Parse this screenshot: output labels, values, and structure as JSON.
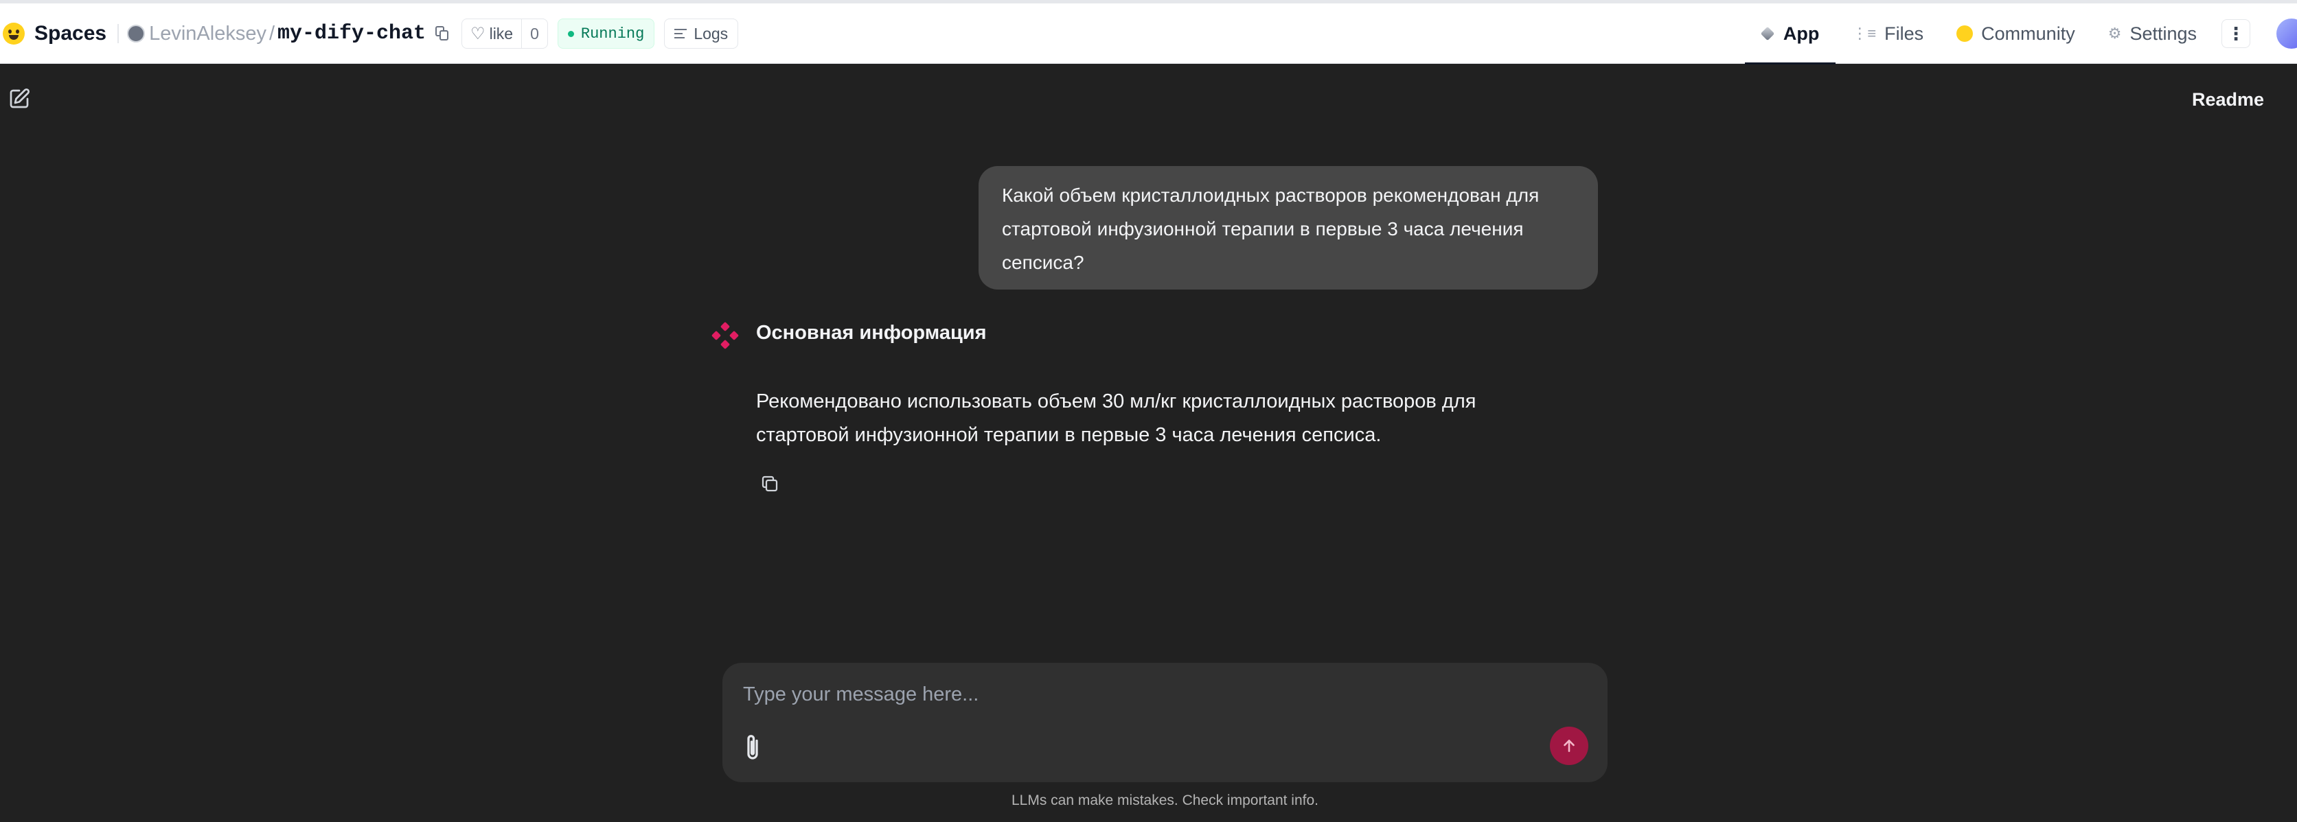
{
  "header": {
    "brand": "Spaces",
    "owner": "LevinAleksey",
    "separator": "/",
    "repo": "my-dify-chat",
    "like_label": "like",
    "like_count": "0",
    "status": "Running",
    "logs_label": "Logs",
    "tabs": [
      {
        "label": "App",
        "icon": "cube-icon",
        "active": true
      },
      {
        "label": "Files",
        "icon": "files-icon",
        "active": false
      },
      {
        "label": "Community",
        "icon": "hf-community-icon",
        "active": false
      },
      {
        "label": "Settings",
        "icon": "gear-icon",
        "active": false
      }
    ],
    "more_icon": "⋮"
  },
  "app": {
    "readme_label": "Readme",
    "user_message": "Какой объем кристаллоидных растворов рекомендован для стартовой инфузионной терапии в первые 3 часа лечения сепсиса?",
    "bot_name": "Основная информация",
    "bot_answer": "Рекомендовано использовать объем 30 мл/кг кристаллоидных растворов для стартовой инфузионной терапии в первые 3 часа лечения сепсиса.",
    "composer_placeholder": "Type your message here...",
    "composer_value": "",
    "disclaimer": "LLMs can make mistakes. Check important info."
  },
  "colors": {
    "background": "#212121",
    "user_bubble": "#474747",
    "composer": "#303030",
    "send_button": "#a01743",
    "bot_avatar": "#e11d62",
    "status": "#10b981"
  }
}
